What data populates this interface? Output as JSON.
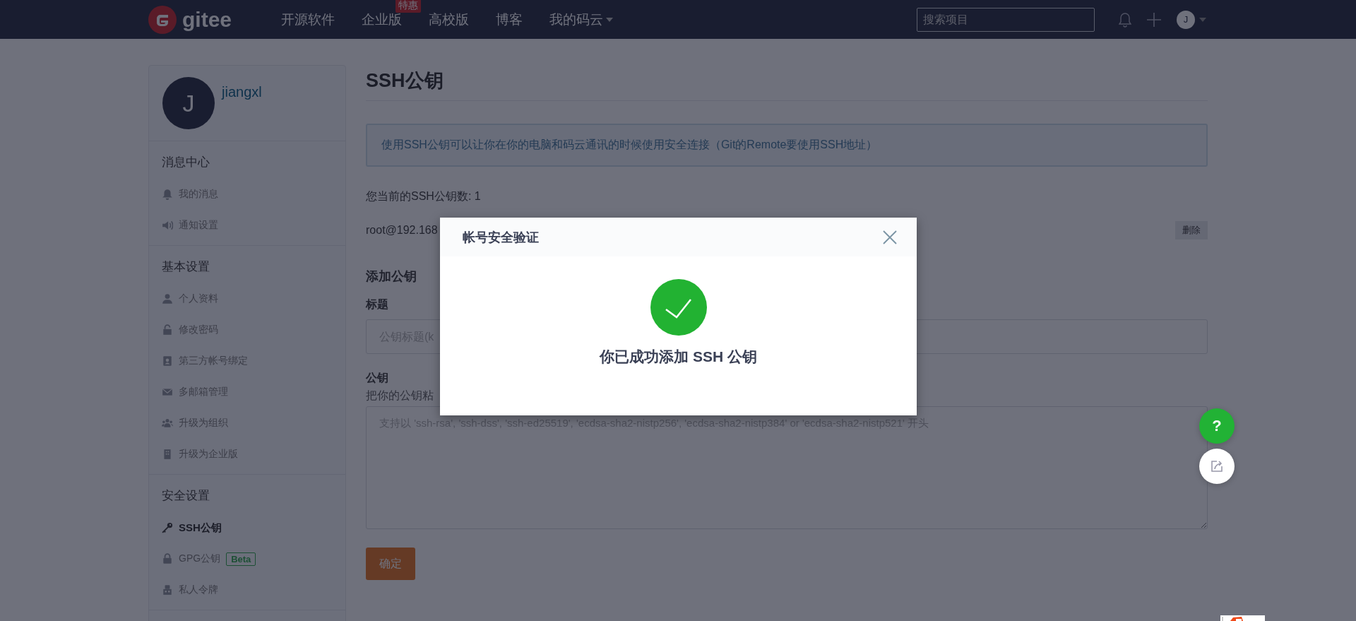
{
  "nav": {
    "brand": "gitee",
    "items": [
      {
        "label": "开源软件"
      },
      {
        "label": "企业版",
        "badge": "特惠"
      },
      {
        "label": "高校版"
      },
      {
        "label": "博客"
      },
      {
        "label": "我的码云",
        "dropdown": true
      }
    ],
    "search": {
      "placeholder": "搜索项目"
    },
    "avatar": "J"
  },
  "sidebar": {
    "user": {
      "initial": "J",
      "name": "jiangxl"
    },
    "sections": [
      {
        "title": "消息中心",
        "items": [
          {
            "label": "我的消息",
            "selected": false
          },
          {
            "label": "通知设置",
            "selected": false
          }
        ]
      },
      {
        "title": "基本设置",
        "items": [
          {
            "label": "个人资料",
            "selected": false
          },
          {
            "label": "修改密码",
            "selected": false
          },
          {
            "label": "第三方帐号绑定",
            "selected": false
          },
          {
            "label": "多邮箱管理",
            "selected": false
          },
          {
            "label": "升级为组织",
            "selected": false
          },
          {
            "label": "升级为企业版",
            "selected": false
          }
        ]
      },
      {
        "title": "安全设置",
        "items": [
          {
            "label": "SSH公钥",
            "selected": true
          },
          {
            "label": "GPG公钥",
            "selected": false,
            "badge": "Beta"
          },
          {
            "label": "私人令牌",
            "selected": false
          }
        ]
      }
    ]
  },
  "main": {
    "title": "SSH公钥",
    "notice": "使用SSH公钥可以让你在你的电脑和码云通讯的时候使用安全连接（Git的Remote要使用SSH地址）",
    "key_count": "您当前的SSH公钥数: 1",
    "keys": [
      {
        "name": "root@192.168",
        "action": "删除"
      }
    ],
    "add": {
      "heading": "添加公钥",
      "title_label": "标题",
      "title_placeholder": "公钥标题(k",
      "key_label": "公钥",
      "key_hint": "把你的公钥粘",
      "key_placeholder": "支持以 'ssh-rsa', 'ssh-dss', 'ssh-ed25519', 'ecdsa-sha2-nistp256', 'ecdsa-sha2-nistp384' or 'ecdsa-sha2-nistp521' 开头",
      "submit": "确定"
    }
  },
  "float_buttons": {
    "help": "?"
  },
  "modal": {
    "title": "帐号安全验证",
    "message": "你已成功添加 SSH 公钥"
  }
}
